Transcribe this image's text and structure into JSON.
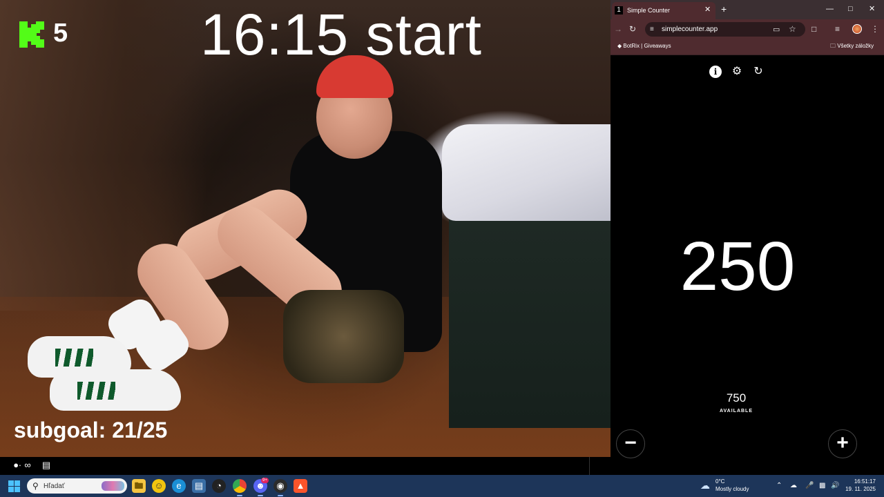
{
  "stream": {
    "viewer_count": "5",
    "start_text": "16:15 start",
    "subgoal": "subgoal: 21/25"
  },
  "browser": {
    "tab_title": "Simple Counter",
    "tab_favicon": "1",
    "url": "simplecounter.app",
    "bookmark_item": "BotRix | Giveaways",
    "bookmark_all": "Všetky záložky"
  },
  "counter": {
    "value": "250",
    "available_value": "750",
    "available_label": "AVAILABLE",
    "minus_label": "−",
    "plus_label": "+"
  },
  "taskbar": {
    "search_placeholder": "Hľadať",
    "weather_temp": "0°C",
    "weather_desc": "Mostly cloudy",
    "clock_time": "16:51:17",
    "clock_date": "19. 11. 2025",
    "discord_badge": "9+"
  },
  "colors": {
    "kick_green": "#53fc18",
    "browser_frame": "#4f2b2f",
    "taskbar_bg": "#1d3559"
  },
  "icons": {
    "stream_bar": [
      "connections-icon",
      "infinity-icon",
      "store-icon"
    ],
    "app": [
      "info-icon",
      "settings-icon",
      "refresh-icon"
    ]
  }
}
